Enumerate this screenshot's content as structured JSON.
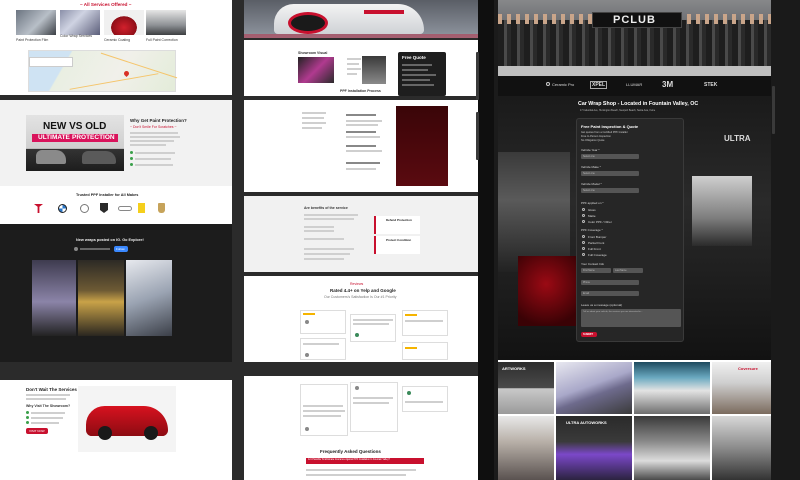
{
  "panel1": {
    "services_heading": "~ All Services Offered ~",
    "service_labels": [
      "Paint Protection Film",
      "Color Wrap Services",
      "Ceramic Coating",
      "Full Paint Correction"
    ],
    "ppf_heading": "Why Get Paint Protection?",
    "ppf_sub": "~ Don't Smile For Scratches ~",
    "promo_new": "NEW VS OLD",
    "promo_ultimate": "ULTIMATE",
    "promo_protection": "PROTECTION",
    "brands_heading": "Trusted PPF Installer for All Makes",
    "reels_heading": "New wraps posted on IG. Go Explore!",
    "follow_label": "Follow",
    "dont_wait": "Don't Wait The Services",
    "why_us": "Why Visit The Showroom?",
    "cta_label": "VISIT NOW"
  },
  "panel2": {
    "showroom_heading": "Showroom Visual",
    "quote_title": "Free Quote",
    "ppf_package": "PPF Installation Process",
    "brake_title": "Are benefits of the service",
    "benefit_a": "Defend Protection",
    "benefit_b": "Protect Condition",
    "rated_tag": "Reviews",
    "rated_title": "Rated 4.4+ on Yelp and Google",
    "rated_sub": "Our Customers's Satisfaction Is Our #1 Priority",
    "faq_title": "Frequently Asked Questions",
    "faq_banner": "Is It Possible To Eliminate Insurance Against PPF Installation In Fountain Valley?"
  },
  "phone": {
    "club_banner": "PCLUB",
    "partner_logos": [
      "Ceramic Pro",
      "XPEL",
      "LLUMAR",
      "3M",
      "STEK"
    ],
    "page_title": "Car Wrap Shop - Located in Fountain Valley, OC",
    "address_line": "17 Industrial Ave, Huntington Beach, Newport Beach, Santa Ana, Irvine",
    "form_title": "Free Paint Inspection & Quote",
    "form_points": [
      "Get quotes from a Certified PPF Installer",
      "Free In-Person Inspection",
      "No Obligation Quote"
    ],
    "fields": [
      {
        "label": "Vehicle Year *",
        "placeholder": "Select one"
      },
      {
        "label": "Vehicle Make *",
        "placeholder": "Select one"
      },
      {
        "label": "Vehicle Model *",
        "placeholder": "Select one"
      }
    ],
    "ppf_type_label": "PPF applied on *",
    "ppf_type_options": [
      "Gloss",
      "Matte",
      "Color PPF / Other"
    ],
    "coverage_label": "PPF Coverage *",
    "coverage_options": [
      "Front Bumper",
      "Partial Front",
      "Full Front",
      "Full Coverage"
    ],
    "contact_label": "Your Contact Info",
    "contact_fields": [
      "First Name",
      "Last Name",
      "Phone",
      "Email"
    ],
    "message_label": "Leave us a message (optional)",
    "message_placeholder": "Tell us about your vehicle, the services you are interested in...",
    "submit_label": "SUBMIT",
    "bg_sign": "ULTRA",
    "gallery_sign": "ARTWORKS",
    "gallery_sign2": "ULTRA AUTOWORKS",
    "side_tag": "Coversure"
  },
  "colors": {
    "accent_red": "#c8102e",
    "dark_panel": "#1e1e1e",
    "field_gray": "#555555"
  }
}
